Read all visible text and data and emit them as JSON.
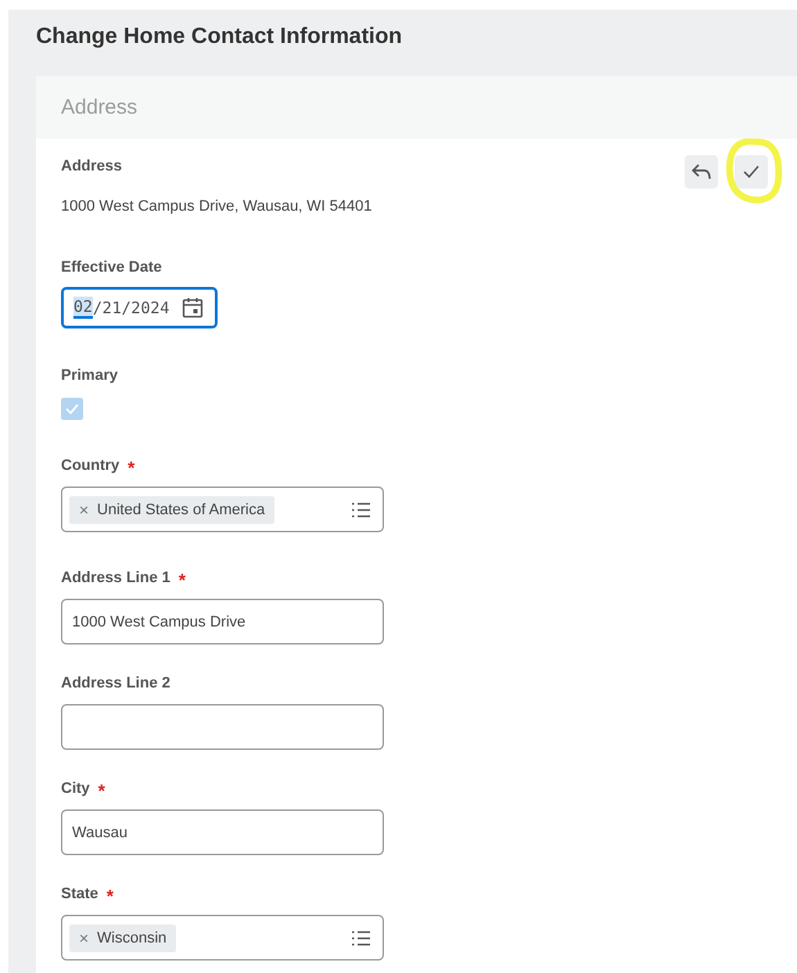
{
  "page": {
    "title": "Change Home Contact Information"
  },
  "card": {
    "header": "Address",
    "actions": [
      {
        "kind": "undo",
        "highlighted": false
      },
      {
        "kind": "check",
        "highlighted": true
      }
    ],
    "fields": [
      {
        "kind": "display",
        "label": "Address",
        "value": "1000 West Campus Drive, Wausau, WI 54401"
      },
      {
        "kind": "date",
        "label": "Effective Date",
        "parts": [
          {
            "text": "02",
            "selected": true
          },
          {
            "text": "/21/2024",
            "selected": false
          }
        ],
        "focused": true
      },
      {
        "kind": "checkbox",
        "label": "Primary",
        "checked": true,
        "disabled": true
      },
      {
        "kind": "multiselect",
        "label": "Country",
        "marker": "*",
        "chip": "United States of America",
        "chip_remove": "×"
      },
      {
        "kind": "text",
        "label": "Address Line 1",
        "marker": "*",
        "value": "1000 West Campus Drive"
      },
      {
        "kind": "text",
        "label": "Address Line 2"
      },
      {
        "kind": "text",
        "label": "City",
        "marker": "*",
        "value": "Wausau"
      },
      {
        "kind": "multiselect",
        "label": "State",
        "marker": "*",
        "chip": "Wisconsin",
        "chip_remove": "×"
      }
    ]
  }
}
